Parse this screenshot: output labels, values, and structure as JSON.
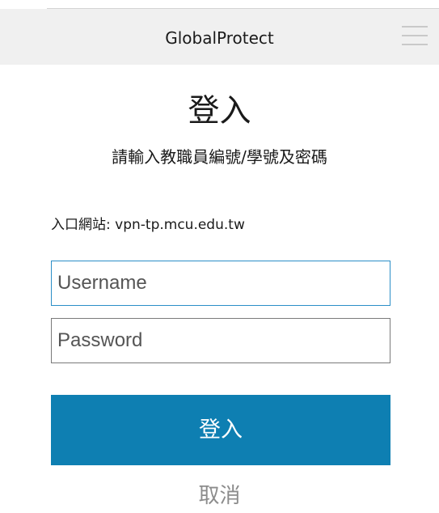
{
  "header": {
    "title": "GlobalProtect",
    "menu_icon": "hamburger-menu-icon"
  },
  "login": {
    "title": "登入",
    "subtitle": "請輸入教職員編號/學號及密碼",
    "portal_label": "入口網站:",
    "portal_value": "vpn-tp.mcu.edu.tw",
    "username_placeholder": "Username",
    "username_value": "",
    "password_placeholder": "Password",
    "password_value": "",
    "submit_label": "登入",
    "cancel_label": "取消"
  },
  "colors": {
    "header_bg": "#f0f0f0",
    "accent": "#0e7fb2",
    "focus_border": "#2b8fc7",
    "cancel_text": "#8c8c8c"
  }
}
